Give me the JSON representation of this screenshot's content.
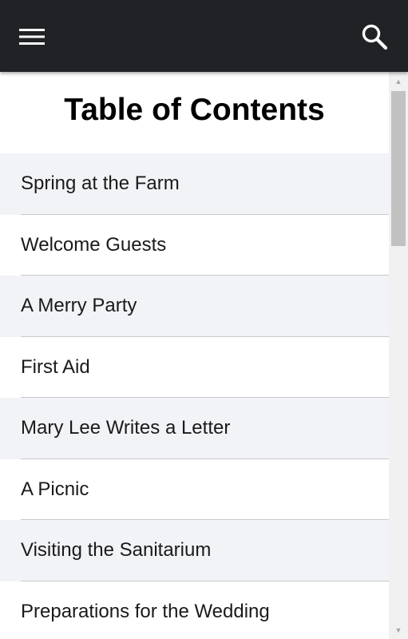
{
  "header": {
    "background": "#212226",
    "menu_icon": "hamburger-menu-icon",
    "search_icon": "search-icon"
  },
  "page_title": "Table of Contents",
  "chapters": [
    "Spring at the Farm",
    "Welcome Guests",
    "A Merry Party",
    "First Aid",
    "Mary Lee Writes a Letter",
    "A Picnic",
    "Visiting the Sanitarium",
    "Preparations for the Wedding"
  ],
  "colors": {
    "row_alt": "#f2f3f7",
    "divider": "#c9c9cc"
  }
}
